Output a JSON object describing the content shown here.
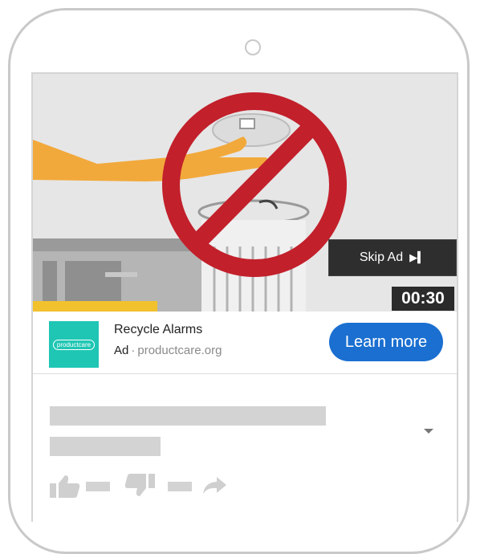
{
  "video": {
    "skip_label": "Skip Ad",
    "skip_icon": "skip-next-icon",
    "timer": "00:30"
  },
  "ad": {
    "logo_text": "productcare",
    "title": "Recycle Alarms",
    "label": "Ad",
    "separator": "·",
    "domain": "productcare.org",
    "cta_label": "Learn more"
  },
  "colors": {
    "cta": "#1a6fd0",
    "logo_bg": "#1fc6b4",
    "prohibition": "#c2202b",
    "arm": "#f2a93b",
    "placeholder": "#d3d3d3"
  },
  "icons": [
    "thumbs-up-icon",
    "thumbs-down-icon",
    "share-icon",
    "chevron-down-icon"
  ]
}
